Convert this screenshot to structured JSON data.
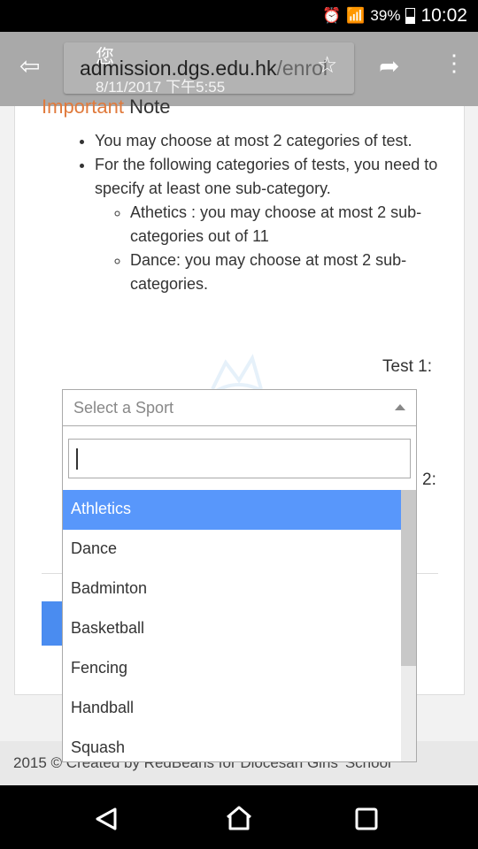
{
  "status_bar": {
    "battery": "39%",
    "time": "10:02",
    "icons": [
      "alarm-icon",
      "wifi-icon",
      "signal-icon",
      "battery-icon"
    ]
  },
  "browser": {
    "url_host": "admission.dgs.edu.hk",
    "url_path": "/enrol",
    "overlay_char": "您",
    "overlay_timestamp": "8/11/2017 下午5:55"
  },
  "note": {
    "title_highlight": "Important",
    "title_rest": "Note",
    "items": [
      "You may choose at most 2 categories of test.",
      "For the following categories of tests, you need to specify at least one sub-category."
    ],
    "sub_items": [
      "Athetics : you may choose at most 2 sub-categories out of 11",
      "Dance: you may choose at most 2 sub-categories."
    ]
  },
  "form": {
    "test1_label": "Test 1:",
    "test2_label": "2:"
  },
  "dropdown": {
    "placeholder": "Select a Sport",
    "search_value": "",
    "highlighted": "Athletics",
    "options": [
      "Athletics",
      "Dance",
      "Badminton",
      "Basketball",
      "Fencing",
      "Handball",
      "Squash"
    ],
    "scroll_fraction": 0.0,
    "highlight_color": "#5897fb"
  },
  "footer": {
    "text": "2015 © Created by RedBeans for Diocesan Girls' School"
  }
}
